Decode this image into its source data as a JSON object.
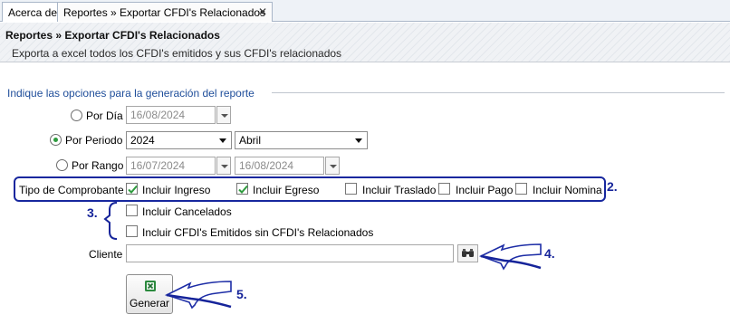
{
  "tabs": [
    {
      "label": "Acerca de"
    },
    {
      "label": "Reportes » Exportar CFDI's Relacionados",
      "close": "✕"
    }
  ],
  "header": {
    "title": "Reportes » Exportar CFDI's Relacionados",
    "subtitle": "Exporta a excel todos los CFDI's emitidos y sus CFDI's relacionados"
  },
  "options": {
    "legend": "Indique las opciones para la generación del reporte",
    "por_dia": {
      "label": "Por Día",
      "date": "16/08/2024",
      "selected": false
    },
    "por_periodo": {
      "label": "Por Periodo",
      "year": "2024",
      "month": "Abril",
      "selected": true
    },
    "por_rango": {
      "label": "Por Rango",
      "from": "16/07/2024",
      "to": "16/08/2024",
      "selected": false
    }
  },
  "tipo_comprobante": {
    "label": "Tipo de Comprobante",
    "items": [
      {
        "label": "Incluir Ingreso",
        "checked": true
      },
      {
        "label": "Incluir Egreso",
        "checked": true
      },
      {
        "label": "Incluir Traslado",
        "checked": false
      },
      {
        "label": "Incluir Pago",
        "checked": false
      },
      {
        "label": "Incluir Nomina",
        "checked": false
      }
    ]
  },
  "extra": {
    "cancelados": {
      "label": "Incluir Cancelados",
      "checked": false
    },
    "sin_relacionados": {
      "label": "Incluir CFDI's Emitidos sin CFDI's Relacionados",
      "checked": false
    }
  },
  "cliente": {
    "label": "Cliente",
    "value": ""
  },
  "generar": {
    "label": "Generar"
  },
  "annotations": {
    "a2": "2.",
    "a3": "3.",
    "a4": "4.",
    "a5": "5."
  },
  "colors": {
    "annotation": "#16249a",
    "legend": "#1f4e9a",
    "check": "#2e9b3e"
  }
}
